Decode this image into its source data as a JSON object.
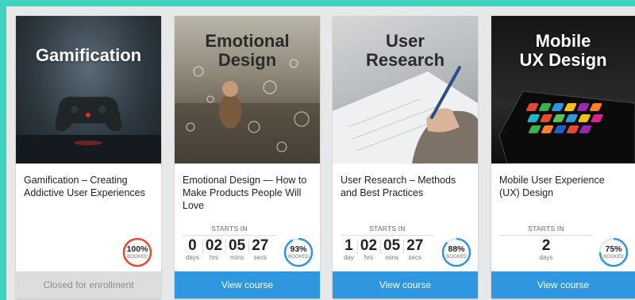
{
  "colors": {
    "accent": "#2f97e0",
    "frame": "#3fd4c2",
    "gauge_full": "#e24a33",
    "gauge_partial": "#2f97e0"
  },
  "cards": [
    {
      "hero_title": "Gamification",
      "course_name": "Gamification – Creating Addictive User Experiences",
      "starts_label": "",
      "booked": {
        "percent": "100%",
        "label": "BOOKED",
        "fraction": 1.0
      },
      "button_label": "Closed for enrollment"
    },
    {
      "hero_title": "Emotional\nDesign",
      "course_name": "Emotional Design — How to Make Products People Will Love",
      "starts_label": "STARTS IN",
      "countdown": [
        {
          "value": "0",
          "unit": "days"
        },
        {
          "value": "02",
          "unit": "hrs"
        },
        {
          "value": "05",
          "unit": "mins"
        },
        {
          "value": "27",
          "unit": "secs"
        }
      ],
      "booked": {
        "percent": "93%",
        "label": "BOOKED",
        "fraction": 0.93
      },
      "button_label": "View course"
    },
    {
      "hero_title": "User\nResearch",
      "course_name": "User Research – Methods and Best Practices",
      "starts_label": "STARTS IN",
      "countdown": [
        {
          "value": "1",
          "unit": "day"
        },
        {
          "value": "02",
          "unit": "hrs"
        },
        {
          "value": "05",
          "unit": "mins"
        },
        {
          "value": "27",
          "unit": "secs"
        }
      ],
      "booked": {
        "percent": "88%",
        "label": "BOOKED",
        "fraction": 0.88
      },
      "button_label": "View course"
    },
    {
      "hero_title": "Mobile\nUX Design",
      "course_name": "Mobile User Experience (UX) Design",
      "starts_label": "STARTS IN",
      "countdown": [
        {
          "value": "2",
          "unit": "days"
        }
      ],
      "booked": {
        "percent": "75%",
        "label": "BOOKED",
        "fraction": 0.75
      },
      "button_label": "View course"
    }
  ]
}
